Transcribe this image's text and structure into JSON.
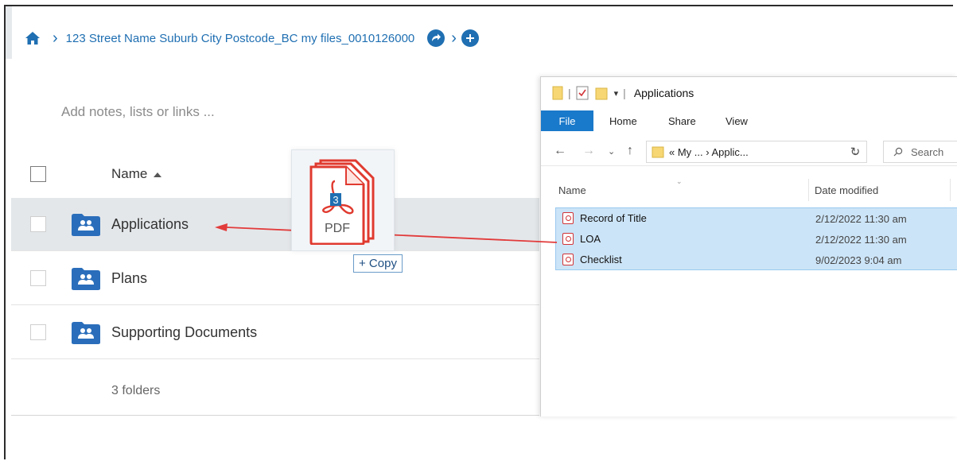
{
  "breadcrumb": {
    "path": "123 Street Name Suburb City Postcode_BC my files_0010126000"
  },
  "notes": {
    "placeholder": "Add notes, lists or links ..."
  },
  "list": {
    "column_name": "Name",
    "rows": [
      {
        "label": "Applications"
      },
      {
        "label": "Plans"
      },
      {
        "label": "Supporting Documents"
      }
    ],
    "folder_count": "3 folders"
  },
  "drag": {
    "count_badge": "3",
    "file_type": "PDF",
    "copy_tooltip": "+ Copy"
  },
  "explorer": {
    "title": "Applications",
    "tabs": [
      "File",
      "Home",
      "Share",
      "View"
    ],
    "address": "« My ... › Applic...",
    "search_placeholder": "Search",
    "col_name": "Name",
    "col_date": "Date modified",
    "files": [
      {
        "name": "Record of Title",
        "date": "2/12/2022 11:30 am"
      },
      {
        "name": "LOA",
        "date": "2/12/2022 11:30 am"
      },
      {
        "name": "Checklist",
        "date": "9/02/2023 9:04 am"
      }
    ]
  },
  "colors": {
    "accent": "#1f6fb2",
    "folder": "#2a6ebb",
    "selection": "#cce4f7",
    "pdf_red": "#e03a2f",
    "drag_arrow": "#e23b3b"
  }
}
